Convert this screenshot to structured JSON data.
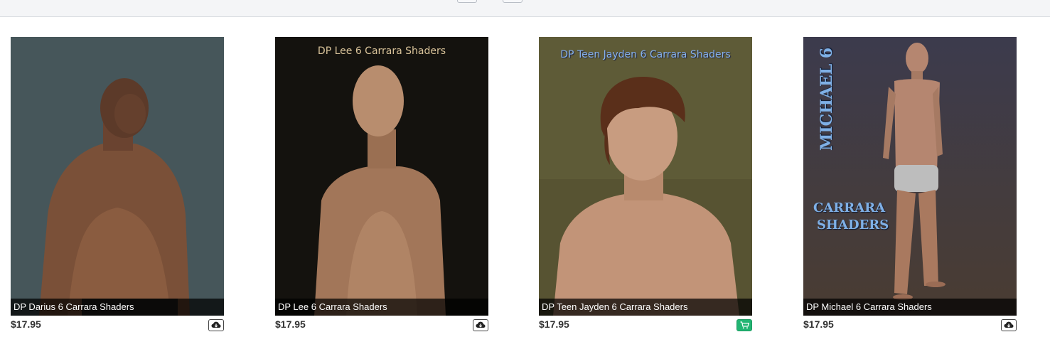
{
  "products": [
    {
      "name": "DP Darius 6 Carrara Shaders",
      "price": "$17.95",
      "action": "download-icon",
      "bg": "#4a5a5e"
    },
    {
      "name": "DP Lee 6 Carrara Shaders",
      "price": "$17.95",
      "action": "download-icon",
      "bg": "#15130f",
      "art_title": "DP Lee 6 Carrara Shaders"
    },
    {
      "name": "DP Teen Jayden 6 Carrara Shaders",
      "price": "$17.95",
      "action": "shopping-cart-icon",
      "bg": "#5d5a36",
      "art_title": "DP Teen Jayden 6 Carrara Shaders"
    },
    {
      "name": "DP Michael 6 Carrara Shaders",
      "price": "$17.95",
      "action": "download-icon",
      "bg": "#3d3a48",
      "art_title_vertical": "MICHAEL 6",
      "art_title_line1": "CARRARA",
      "art_title_line2": "SHADERS"
    }
  ],
  "colors": {
    "cart_green": "#22b573",
    "price_text": "#333333",
    "caption_bg": "#000000"
  }
}
